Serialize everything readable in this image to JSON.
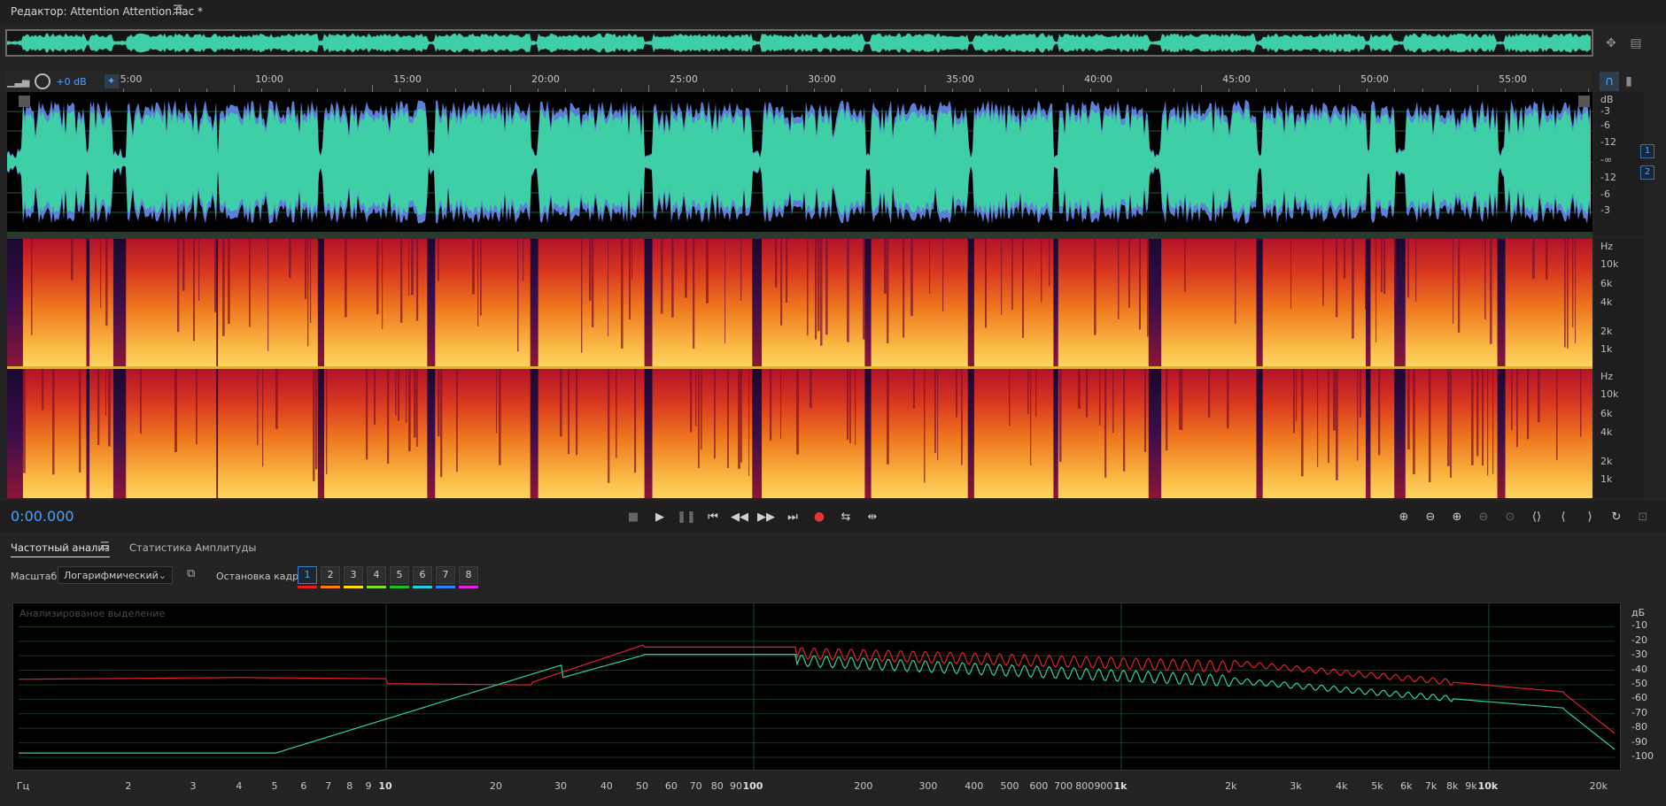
{
  "editor": {
    "title": "Редактор: Attention Attention.flac *",
    "menu_icon": "hamburger-icon"
  },
  "ruler": {
    "gain": "+0 dB",
    "ticks": [
      "5:00",
      "10:00",
      "15:00",
      "20:00",
      "25:00",
      "30:00",
      "35:00",
      "40:00",
      "45:00",
      "50:00",
      "55:00"
    ]
  },
  "wave_scale": {
    "labels": [
      "dB",
      "-3",
      "-6",
      "-12",
      "-∞",
      "-12",
      "-6",
      "-3"
    ]
  },
  "spec_scale": {
    "labels": [
      "Hz",
      "10k",
      "6k",
      "4k",
      "2k",
      "1k"
    ]
  },
  "channels": [
    "1",
    "2"
  ],
  "transport": {
    "timecode": "0:00.000"
  },
  "panel": {
    "tab_freq": "Частотный анализ",
    "tab_amp": "Статистика Амплитуды",
    "scale_label": "Масштаб:",
    "scale_value": "Логарифмический",
    "hold_label": "Остановка кадра:",
    "holds": [
      "1",
      "2",
      "3",
      "4",
      "5",
      "6",
      "7",
      "8"
    ],
    "hold_colors": [
      "#e02020",
      "#ff7f00",
      "#ffe000",
      "#80e020",
      "#20c020",
      "#20d0e0",
      "#3080ff",
      "#e020e0"
    ],
    "plot_caption": "Анализированое выделение"
  },
  "freq_axis": {
    "x_labels": [
      "Гц",
      "2",
      "3",
      "4",
      "5",
      "6",
      "7",
      "8",
      "9",
      "10",
      "20",
      "30",
      "40",
      "50",
      "60",
      "70",
      "80",
      "90",
      "100",
      "200",
      "300",
      "400",
      "500",
      "600",
      "700",
      "800",
      "900",
      "1k",
      "2k",
      "3k",
      "4k",
      "5k",
      "6k",
      "7k",
      "8k",
      "9k",
      "10k",
      "20k"
    ],
    "y_labels": [
      "дБ",
      "-10",
      "-20",
      "-30",
      "-40",
      "-50",
      "-60",
      "-70",
      "-80",
      "-90",
      "-100"
    ]
  },
  "colors": {
    "waveform": "#3fcfa7",
    "timecode": "#4aa3ff",
    "curve_left": "#e0202a",
    "curve_right": "#2ed19b"
  }
}
